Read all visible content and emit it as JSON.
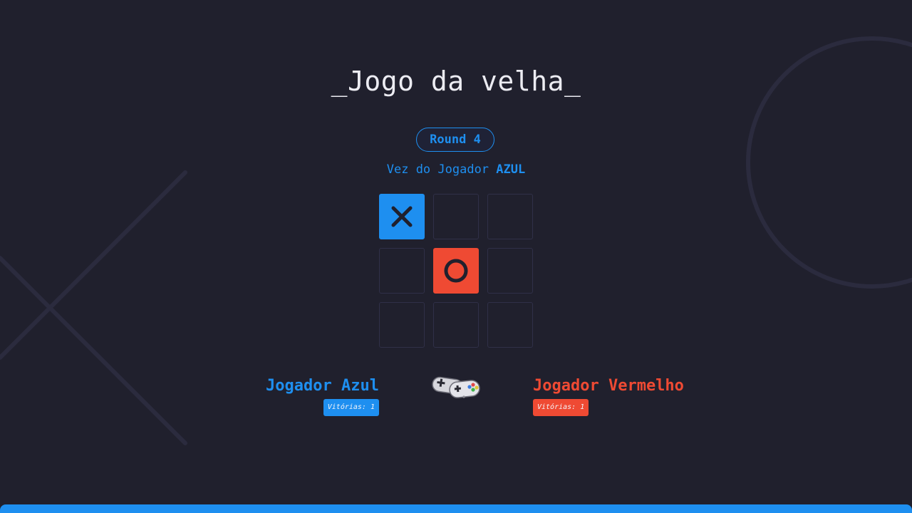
{
  "header": {
    "title": "_Jogo da velha_",
    "round_label": "Round 4",
    "turn_prefix": "Vez do Jogador ",
    "turn_player": "AZUL"
  },
  "board": {
    "cells": [
      "X",
      "",
      "",
      "",
      "O",
      "",
      "",
      "",
      ""
    ]
  },
  "players": {
    "blue": {
      "name": "Jogador Azul",
      "wins": "Vitórias: 1"
    },
    "red": {
      "name": "Jogador Vermelho",
      "wins": "Vitórias: 1"
    }
  },
  "colors": {
    "background": "#20202d",
    "blue": "#1e8ff0",
    "red": "#ef4a33",
    "cell_border": "#303048",
    "decoration": "#2b2b3e"
  },
  "icons": {
    "x_mark": "x-mark-icon",
    "o_mark": "o-mark-icon",
    "controller": "game-controller-icon"
  }
}
